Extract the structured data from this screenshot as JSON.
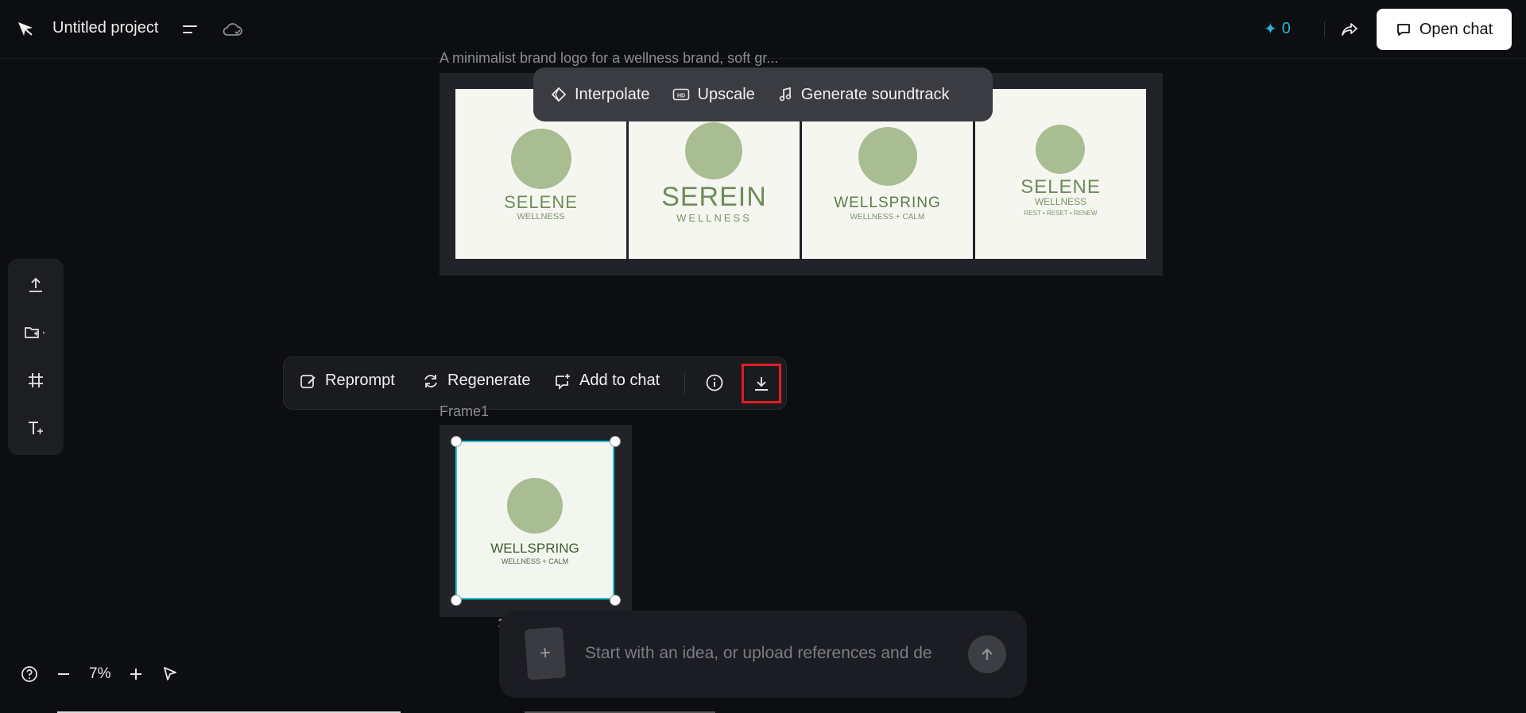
{
  "header": {
    "project_title": "Untitled project",
    "credits": "0",
    "open_chat_label": "Open chat"
  },
  "canvas": {
    "prompt_caption": "A minimalist brand logo for a wellness brand, soft gr...",
    "frame_caption": "Frame1",
    "tiles": [
      {
        "name": "SELENE",
        "sub": "WELLNESS"
      },
      {
        "name": "SEREIN",
        "sub": "WELLNESS"
      },
      {
        "name": "WELLSPRING",
        "sub": "WELLNESS + CALM"
      },
      {
        "name": "SELENE",
        "sub": "WELLNESS",
        "tag": "REST • RESET • RENEW"
      }
    ],
    "selected_tile": {
      "name": "WELLSPRING",
      "sub": "WELLNESS + CALM"
    },
    "stub_number": "1("
  },
  "toolbar_top": {
    "interpolate": "Interpolate",
    "upscale": "Upscale",
    "soundtrack": "Generate soundtrack"
  },
  "toolbar_mid": {
    "reprompt": "Reprompt",
    "regenerate": "Regenerate",
    "add_to_chat": "Add to chat"
  },
  "zoom": {
    "level": "7%"
  },
  "chat": {
    "placeholder": "Start with an idea, or upload references and de"
  },
  "colors": {
    "accent": "#24b6d6",
    "highlight": "#e31b23",
    "selection": "#20c6dc"
  }
}
